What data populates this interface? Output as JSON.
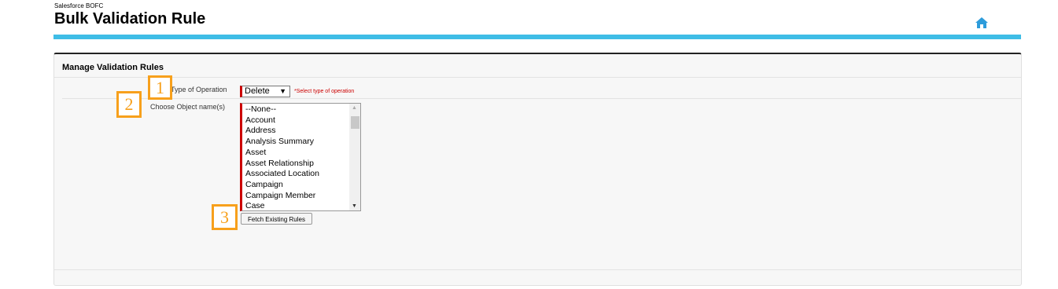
{
  "header": {
    "app_name": "Salesforce BOFC",
    "title": "Bulk Validation Rule",
    "home_icon": "home-icon",
    "accent_color": "#3fbde6"
  },
  "panel": {
    "title": "Manage Validation Rules",
    "type_label": "Type of Operation",
    "type_value": "Delete",
    "type_hint": "*Select type of operation",
    "object_label": "Choose Object name(s)",
    "objects": [
      "--None--",
      "Account",
      "Address",
      "Analysis Summary",
      "Asset",
      "Asset Relationship",
      "Associated Location",
      "Campaign",
      "Campaign Member",
      "Case"
    ],
    "fetch_label": "Fetch Existing Rules"
  },
  "callouts": [
    "1",
    "2",
    "3"
  ]
}
